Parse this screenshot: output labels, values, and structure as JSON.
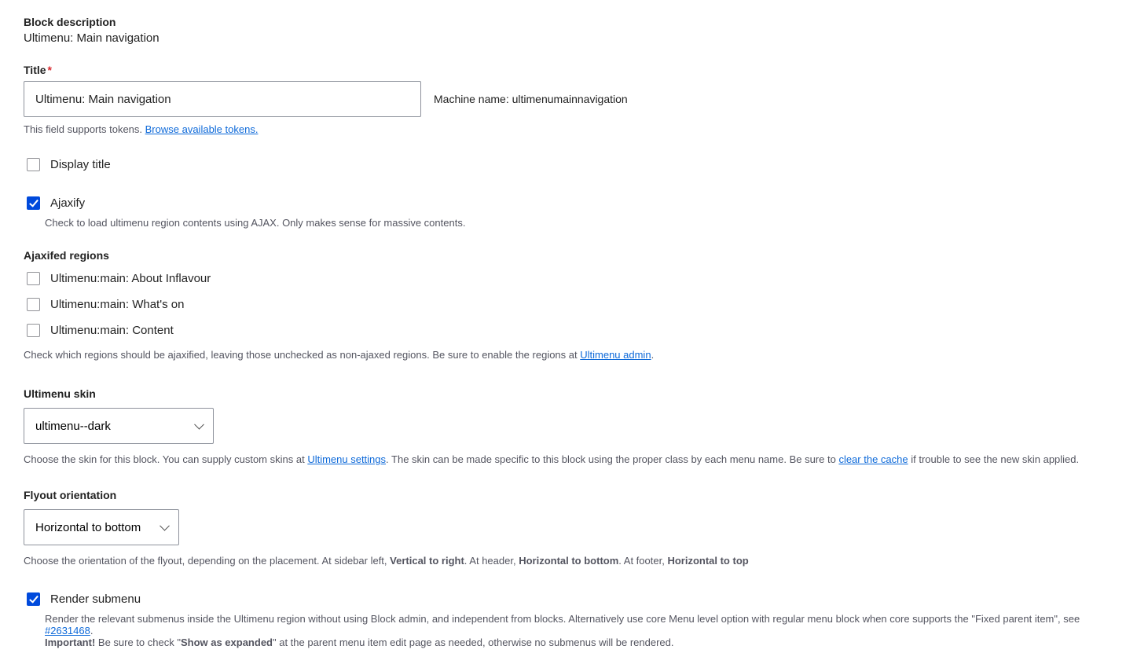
{
  "block_description": {
    "label": "Block description",
    "value": "Ultimenu: Main navigation"
  },
  "title": {
    "label": "Title",
    "required_mark": "*",
    "value": "Ultimenu: Main navigation",
    "machine_name_label": "Machine name: ",
    "machine_name_value": "ultimenumainnavigation",
    "help_pre": "This field supports tokens. ",
    "help_link": "Browse available tokens."
  },
  "display_title": {
    "label": "Display title"
  },
  "ajaxify": {
    "label": "Ajaxify",
    "help": "Check to load ultimenu region contents using AJAX. Only makes sense for massive contents."
  },
  "ajaxified_regions": {
    "label": "Ajaxifed regions",
    "items": [
      "Ultimenu:main: About Inflavour",
      "Ultimenu:main: What's on",
      "Ultimenu:main: Content"
    ],
    "help_pre": "Check which regions should be ajaxified, leaving those unchecked as non-ajaxed regions. Be sure to enable the regions at ",
    "help_link": "Ultimenu admin",
    "help_post": "."
  },
  "skin": {
    "label": "Ultimenu skin",
    "value": "ultimenu--dark",
    "help_pre": "Choose the skin for this block. You can supply custom skins at ",
    "help_link1": "Ultimenu settings",
    "help_mid": ". The skin can be made specific to this block using the proper class by each menu name. Be sure to ",
    "help_link2": "clear the cache",
    "help_post": " if trouble to see the new skin applied."
  },
  "flyout": {
    "label": "Flyout orientation",
    "value": "Horizontal to bottom",
    "help_pre": "Choose the orientation of the flyout, depending on the placement. At sidebar left, ",
    "bold1": "Vertical to right",
    "mid1": ". At header, ",
    "bold2": "Horizontal to bottom",
    "mid2": ". At footer, ",
    "bold3": "Horizontal to top"
  },
  "render_submenu": {
    "label": "Render submenu",
    "help_pre": "Render the relevant submenus inside the Ultimenu region without using Block admin, and independent from blocks. Alternatively use core Menu level option with regular menu block when core supports the \"Fixed parent item\", see ",
    "help_link": "#2631468",
    "help_post": ". ",
    "important_label": "Important!",
    "important_pre": " Be sure to check \"",
    "important_bold": "Show as expanded",
    "important_post": "\" at the parent menu item edit page as needed, otherwise no submenus will be rendered."
  }
}
